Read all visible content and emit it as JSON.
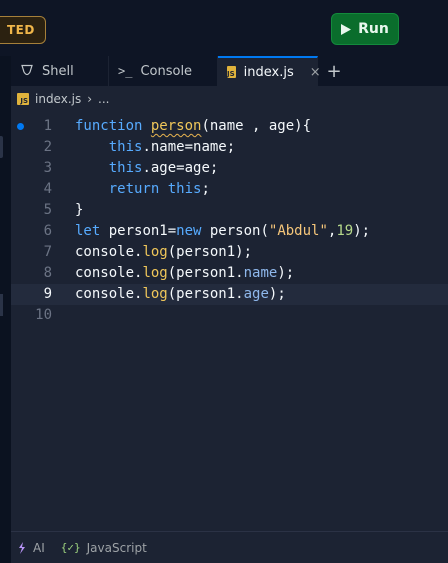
{
  "topbar": {
    "badge": "TED",
    "run_label": "Run"
  },
  "tabs": [
    {
      "label": "Shell",
      "icon": "shell-icon"
    },
    {
      "label": "Console",
      "icon": "console-icon"
    },
    {
      "label": "index.js",
      "icon": "js-file-icon",
      "close": "×",
      "active": true
    }
  ],
  "add_tab": "+",
  "breadcrumb": {
    "file": "index.js",
    "sep": "›",
    "more": "..."
  },
  "line_numbers": [
    "1",
    "2",
    "3",
    "4",
    "5",
    "6",
    "7",
    "8",
    "9",
    "10"
  ],
  "code": [
    [
      [
        "kw",
        "function"
      ],
      [
        "sp",
        " "
      ],
      [
        "fn",
        "person"
      ],
      [
        "",
        "(name , age){"
      ]
    ],
    [
      [
        "",
        "    "
      ],
      [
        "kw",
        "this"
      ],
      [
        "",
        ".name=name;"
      ]
    ],
    [
      [
        "",
        "    "
      ],
      [
        "kw",
        "this"
      ],
      [
        "",
        ".age=age;"
      ]
    ],
    [
      [
        "",
        "    "
      ],
      [
        "kw",
        "return"
      ],
      [
        "",
        " "
      ],
      [
        "kw",
        "this"
      ],
      [
        "",
        ";"
      ]
    ],
    [
      [
        "",
        "}"
      ]
    ],
    [
      [
        "kw",
        "let"
      ],
      [
        "",
        " person1="
      ],
      [
        "kw",
        "new"
      ],
      [
        "",
        " person("
      ],
      [
        "str",
        "\"Abdul\""
      ],
      [
        "",
        ","
      ],
      [
        "num",
        "19"
      ],
      [
        "",
        ");"
      ]
    ],
    [
      [
        "",
        "console."
      ],
      [
        "fn",
        "log"
      ],
      [
        "",
        "(person1);"
      ]
    ],
    [
      [
        "",
        "console."
      ],
      [
        "fn",
        "log"
      ],
      [
        "",
        "(person1."
      ],
      [
        "prop",
        "name"
      ],
      [
        "",
        ");"
      ]
    ],
    [
      [
        "",
        "console."
      ],
      [
        "fn",
        "log"
      ],
      [
        "",
        "(person1."
      ],
      [
        "prop",
        "age"
      ],
      [
        "",
        ");"
      ]
    ],
    [
      [
        "",
        ""
      ]
    ]
  ],
  "active_line": 9,
  "status": {
    "ai_label": "AI",
    "lang_label": "JavaScript"
  },
  "colors": {
    "accent": "#0079f2",
    "run": "#0a6d2c",
    "editor_bg": "#1c2333"
  }
}
